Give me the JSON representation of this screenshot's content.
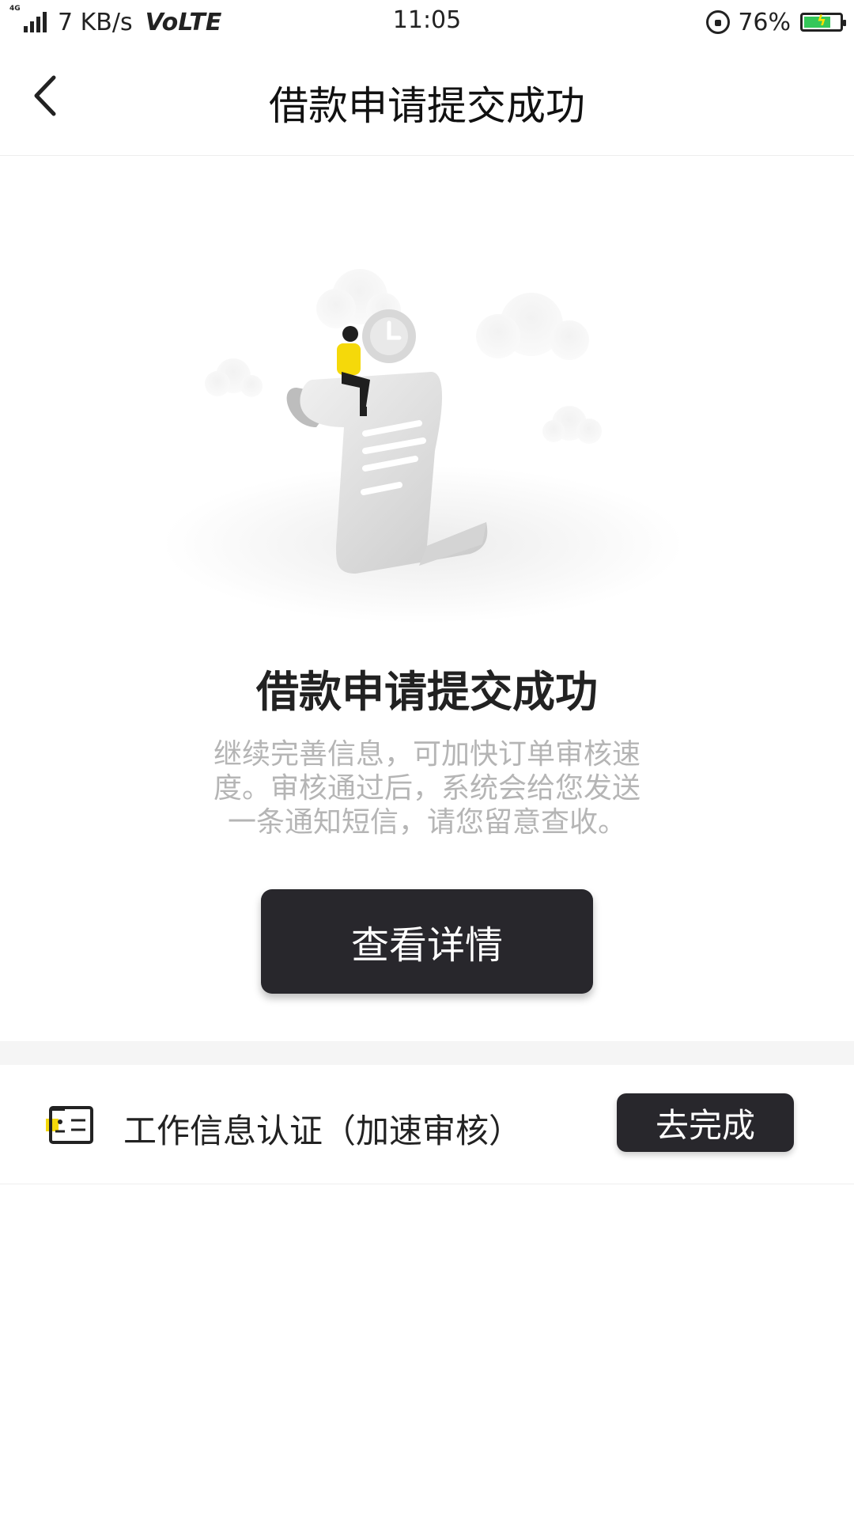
{
  "status_bar": {
    "network": "4G",
    "speed": "7 KB/s",
    "volte": "VoLTE",
    "time": "11:05",
    "battery_percent": "76%",
    "battery_level": 0.76,
    "icons": [
      "signal-icon",
      "rotation-lock-icon",
      "battery-icon"
    ]
  },
  "header": {
    "back_icon": "chevron-left-icon",
    "title": "借款申请提交成功"
  },
  "main": {
    "illustration": "person-on-scroll-with-clock-illustration",
    "title": "借款申请提交成功",
    "description": "继续完善信息，可加快订单审核速度。审核通过后，系统会给您发送一条通知短信，请您留意查收。",
    "detail_button": "查看详情"
  },
  "task": {
    "icon": "id-card-icon",
    "label": "工作信息认证（加速审核）",
    "button": "去完成"
  },
  "colors": {
    "button_bg": "#28272c",
    "accent_yellow": "#f5d90a",
    "battery_green": "#34c759",
    "desc_text": "#b5b5b5"
  }
}
